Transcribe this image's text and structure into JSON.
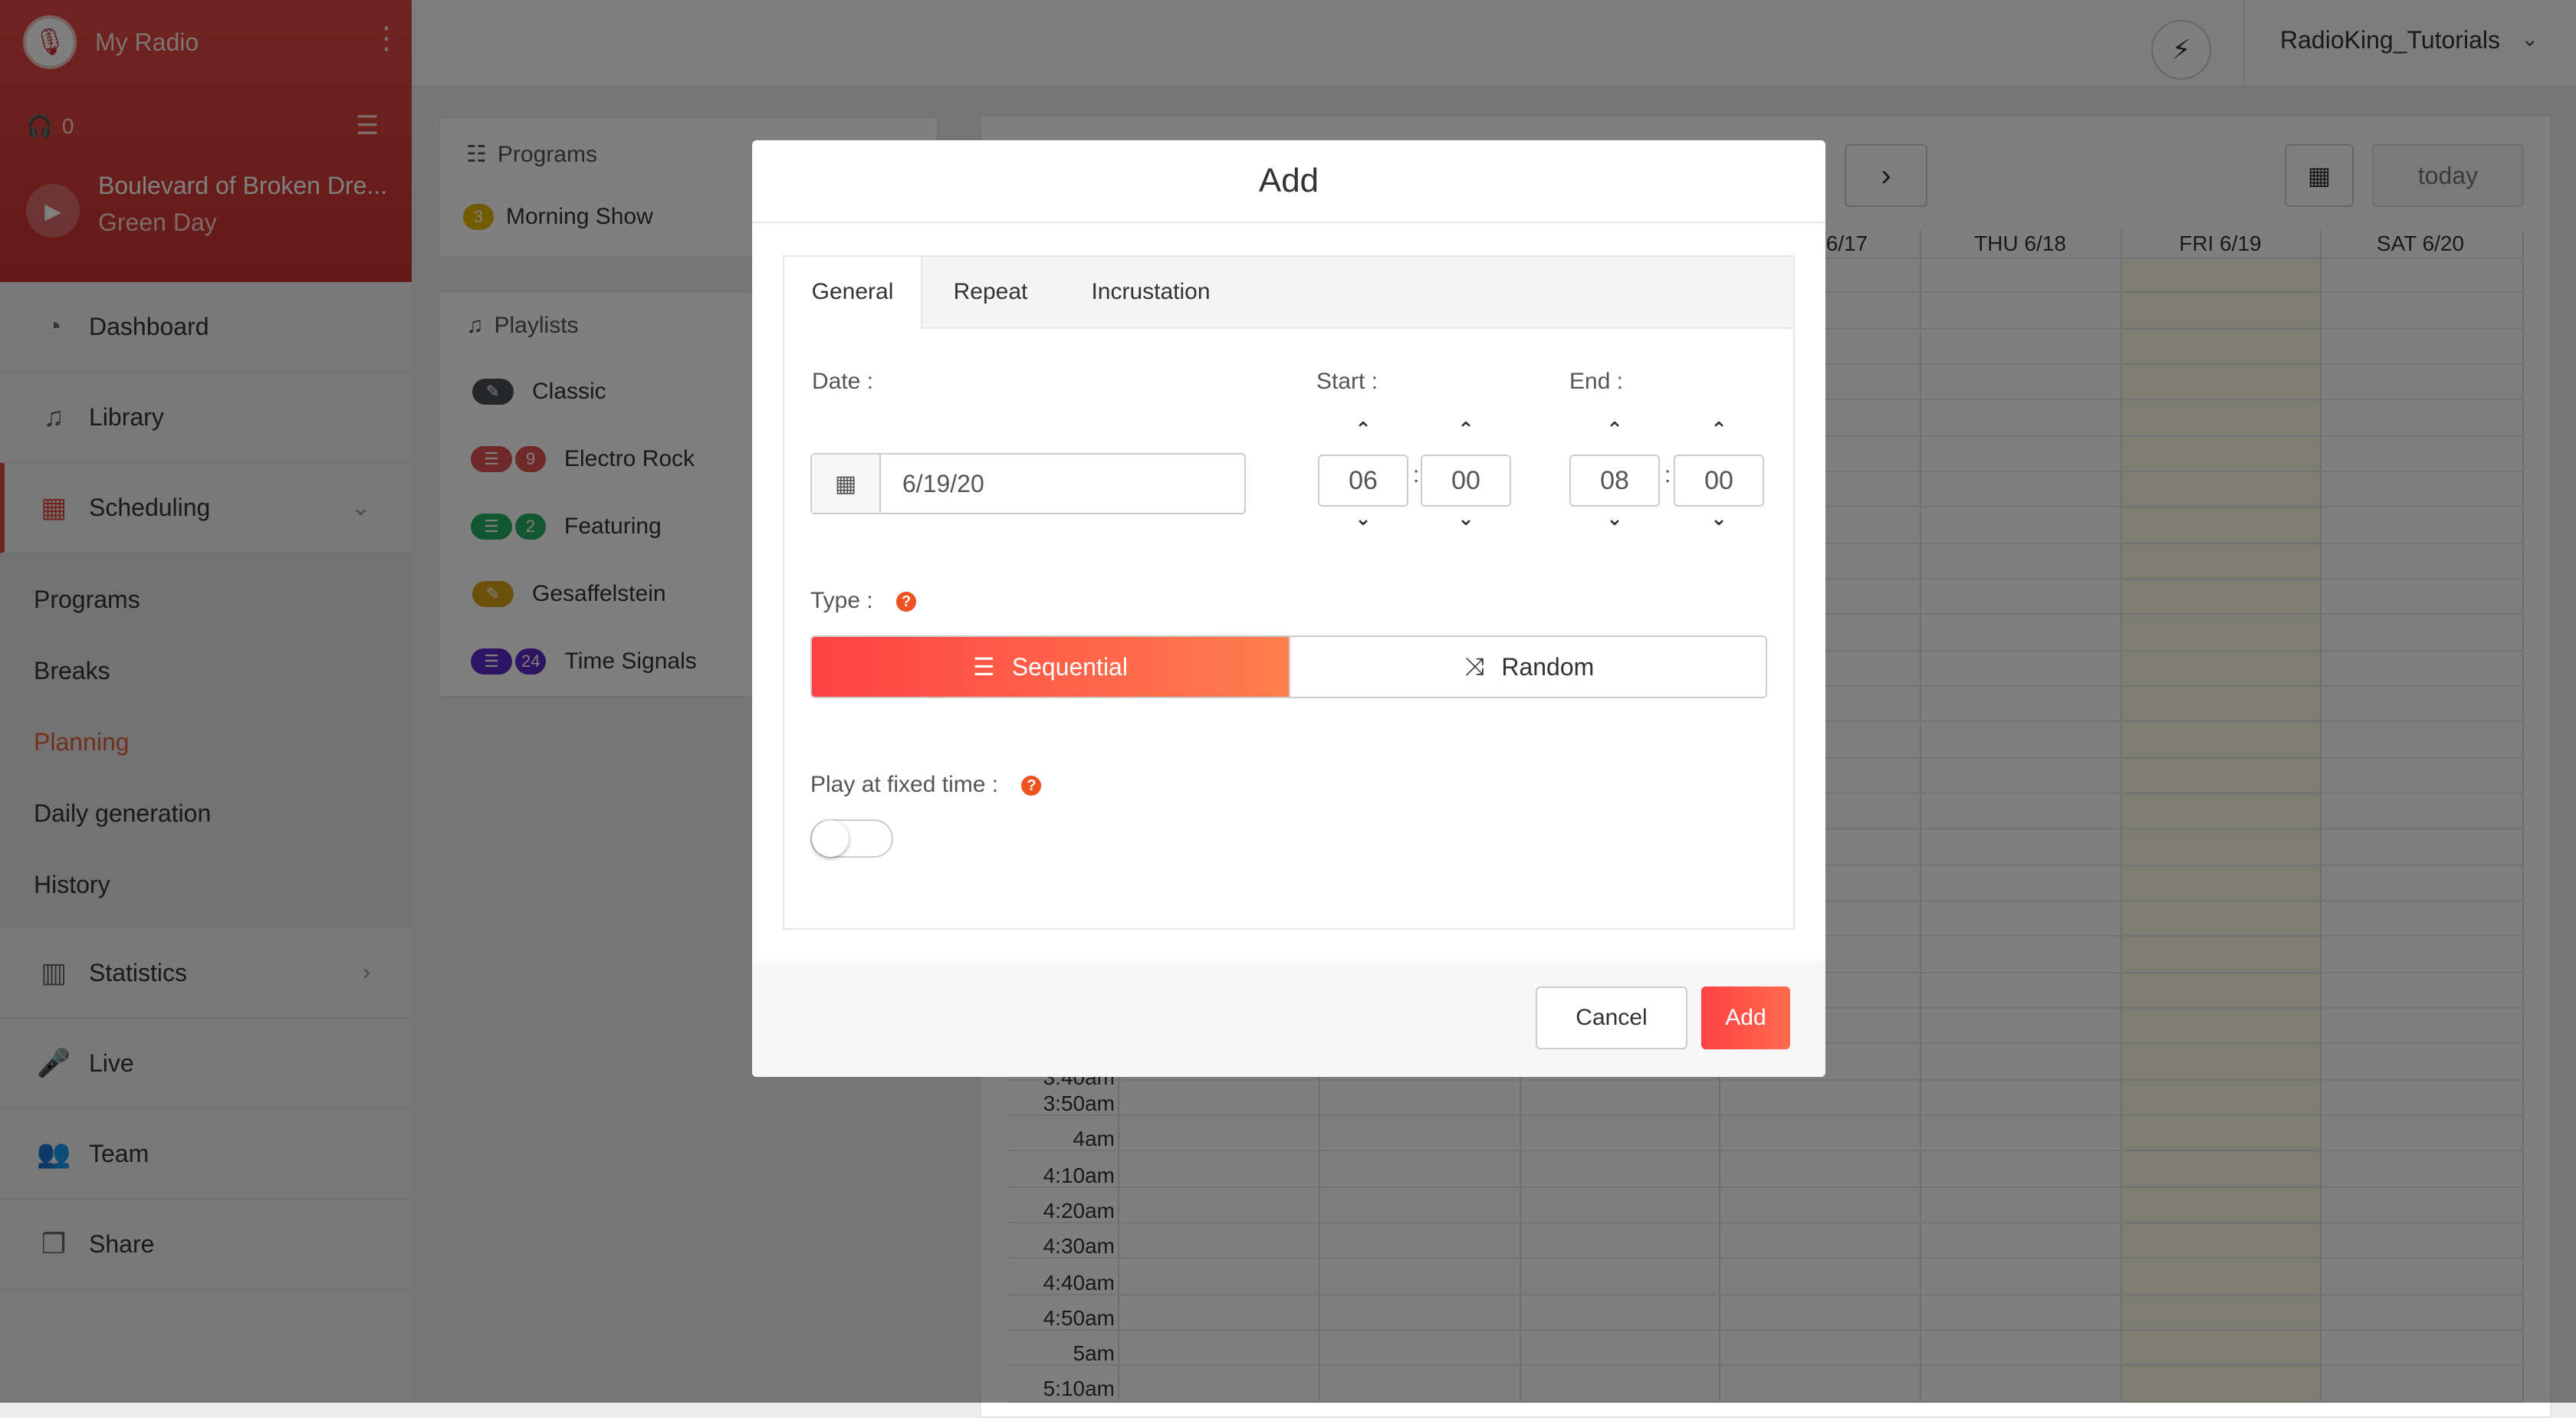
{
  "app": {
    "name": "My Radio"
  },
  "player": {
    "listeners": "0",
    "track_title": "Boulevard of Broken Dre...",
    "track_artist": "Green Day"
  },
  "sidebar": {
    "items": [
      {
        "label": "Dashboard"
      },
      {
        "label": "Library"
      },
      {
        "label": "Scheduling"
      },
      {
        "label": "Statistics"
      },
      {
        "label": "Live"
      },
      {
        "label": "Team"
      },
      {
        "label": "Share"
      }
    ],
    "scheduling_sub": [
      {
        "label": "Programs"
      },
      {
        "label": "Breaks"
      },
      {
        "label": "Planning"
      },
      {
        "label": "Daily generation"
      },
      {
        "label": "History"
      }
    ]
  },
  "topbar": {
    "username": "RadioKing_Tutorials"
  },
  "programs_panel": {
    "title": "Programs",
    "items": [
      {
        "badge": "3",
        "name": "Morning Show",
        "color": "#e6b800"
      }
    ]
  },
  "playlists_panel": {
    "title": "Playlists",
    "items": [
      {
        "name": "Classic",
        "count": "",
        "color": "#4a4f57"
      },
      {
        "name": "Electro Rock",
        "count": "9",
        "color": "#e05252"
      },
      {
        "name": "Featuring",
        "count": "2",
        "color": "#27ae60"
      },
      {
        "name": "Gesaffelstein",
        "count": "",
        "color": "#d4a017"
      },
      {
        "name": "Time Signals",
        "count": "24",
        "color": "#5b2bc9"
      }
    ]
  },
  "calendar": {
    "today_label": "today",
    "columns": [
      "6/17",
      "THU 6/18",
      "FRI 6/19",
      "SAT 6/20"
    ],
    "times": [
      "3:40am",
      "3:50am",
      "4am",
      "4:10am",
      "4:20am",
      "4:30am",
      "4:40am",
      "4:50am",
      "5am",
      "5:10am"
    ]
  },
  "modal": {
    "title": "Add",
    "tabs": [
      "General",
      "Repeat",
      "Incrustation"
    ],
    "date_label": "Date :",
    "date_value": "6/19/20",
    "start_label": "Start :",
    "end_label": "End :",
    "start_hour": "06",
    "start_min": "00",
    "end_hour": "08",
    "end_min": "00",
    "type_label": "Type :",
    "type_sequential": "Sequential",
    "type_random": "Random",
    "fixed_label": "Play at fixed time :",
    "cancel_label": "Cancel",
    "add_label": "Add"
  },
  "colors": {
    "accent": "#e24a44",
    "primary_gradient_start": "#ff4245",
    "primary_gradient_end": "#ff7e4d"
  }
}
